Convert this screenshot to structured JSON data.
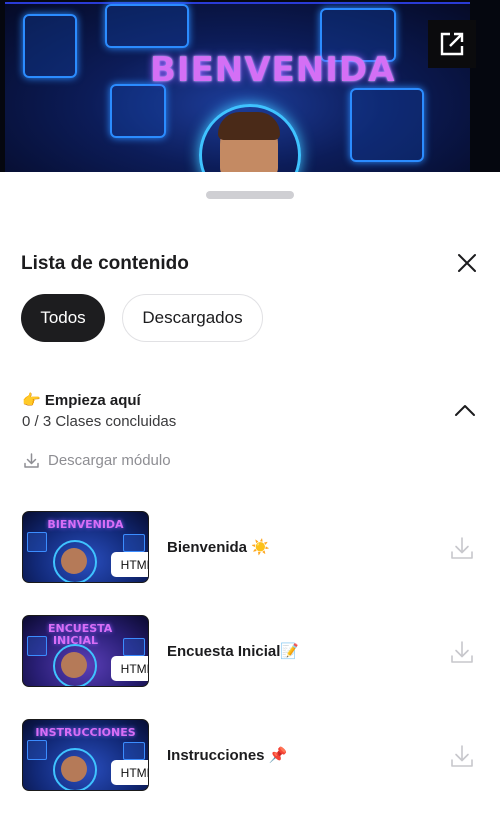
{
  "hero": {
    "title": "BIENVENIDA"
  },
  "sheet": {
    "title": "Lista de contenido",
    "filters": [
      {
        "label": "Todos",
        "selected": true
      },
      {
        "label": "Descargados",
        "selected": false
      }
    ]
  },
  "module": {
    "emoji": "👉",
    "title": "Empieza aquí",
    "progress": "0 / 3 Clases concluidas",
    "download_label": "Descargar módulo"
  },
  "lessons": [
    {
      "title": "Bienvenida",
      "emoji": "☀️",
      "thumb_text": "BIENVENIDA",
      "badge": "HTML"
    },
    {
      "title": "Encuesta Inicial",
      "emoji": "📝",
      "thumb_text": "ENCUESTA INICIAL",
      "badge": "HTML"
    },
    {
      "title": "Instrucciones",
      "emoji": "📌",
      "thumb_text": "INSTRUCCIONES",
      "badge": "HTML"
    }
  ]
}
